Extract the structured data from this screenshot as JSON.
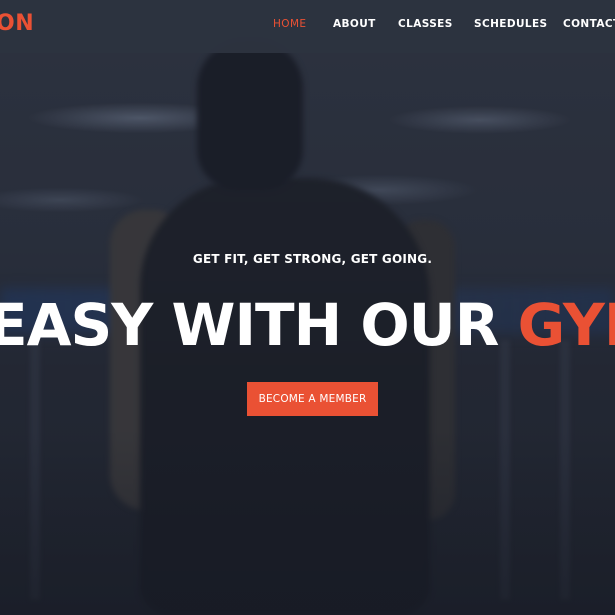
{
  "brand": {
    "logo_text": "ON",
    "accent_color": "#ea5134"
  },
  "nav": {
    "items": [
      {
        "label": "HOME",
        "active": true
      },
      {
        "label": "ABOUT",
        "active": false
      },
      {
        "label": "CLASSES",
        "active": false
      },
      {
        "label": "SCHEDULES",
        "active": false
      },
      {
        "label": "CONTACT",
        "active": false
      }
    ]
  },
  "hero": {
    "tagline": "GET FIT, GET STRONG, GET GOING.",
    "headline_main": "EASY WITH OUR ",
    "headline_accent": "GYM",
    "cta_label": "BECOME A MEMBER",
    "cta_color": "#ea5134"
  }
}
